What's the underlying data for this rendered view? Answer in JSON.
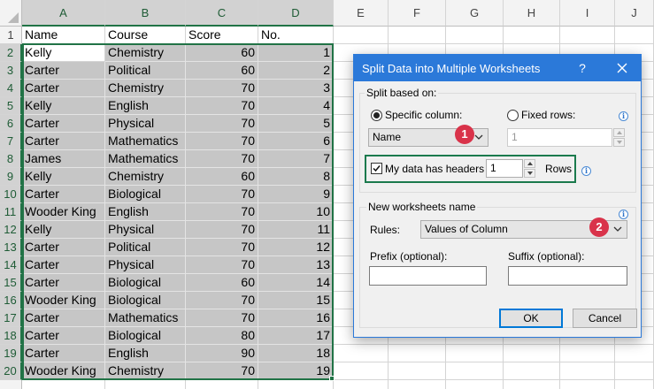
{
  "spreadsheet": {
    "columns": [
      "A",
      "B",
      "C",
      "D",
      "E",
      "F",
      "G",
      "H",
      "I",
      "J"
    ],
    "rows": [
      [
        "Name",
        "Course",
        "Score",
        "No."
      ],
      [
        "Kelly",
        "Chemistry",
        "60",
        "1"
      ],
      [
        "Carter",
        "Political",
        "60",
        "2"
      ],
      [
        "Carter",
        "Chemistry",
        "70",
        "3"
      ],
      [
        "Kelly",
        "English",
        "70",
        "4"
      ],
      [
        "Carter",
        "Physical",
        "70",
        "5"
      ],
      [
        "Carter",
        "Mathematics",
        "70",
        "6"
      ],
      [
        "James",
        "Mathematics",
        "70",
        "7"
      ],
      [
        "Kelly",
        "Chemistry",
        "60",
        "8"
      ],
      [
        "Carter",
        "Biological",
        "70",
        "9"
      ],
      [
        "Wooder King",
        "English",
        "70",
        "10"
      ],
      [
        "Kelly",
        "Physical",
        "70",
        "11"
      ],
      [
        "Carter",
        "Political",
        "70",
        "12"
      ],
      [
        "Carter",
        "Physical",
        "70",
        "13"
      ],
      [
        "Carter",
        "Biological",
        "60",
        "14"
      ],
      [
        "Wooder King",
        "Biological",
        "70",
        "15"
      ],
      [
        "Carter",
        "Mathematics",
        "70",
        "16"
      ],
      [
        "Carter",
        "Biological",
        "80",
        "17"
      ],
      [
        "Carter",
        "English",
        "90",
        "18"
      ],
      [
        "Wooder King",
        "Chemistry",
        "70",
        "19"
      ]
    ]
  },
  "dialog": {
    "title": "Split Data into Multiple Worksheets",
    "help_label": "?",
    "split_based_on": {
      "legend": "Split based on:",
      "specific_column_label": "Specific column:",
      "specific_column_selected": true,
      "column_value": "Name",
      "fixed_rows_label": "Fixed rows:",
      "fixed_rows_selected": false,
      "fixed_rows_value": "1",
      "headers_label": "My data has headers",
      "headers_checked": true,
      "header_rows_value": "1",
      "rows_label": "Rows"
    },
    "new_names": {
      "legend": "New worksheets name",
      "rules_label": "Rules:",
      "rules_value": "Values of Column",
      "prefix_label": "Prefix (optional):",
      "prefix_value": "",
      "suffix_label": "Suffix (optional):",
      "suffix_value": ""
    },
    "ok_label": "OK",
    "cancel_label": "Cancel",
    "info_glyph": "i",
    "badges": [
      "1",
      "2"
    ]
  },
  "colors": {
    "accent_blue": "#2b79d9",
    "excel_green": "#217346",
    "badge_red": "#d9334a",
    "selection_gray": "#c6c6c6"
  },
  "icons": [
    "close-icon",
    "chevron-down-icon",
    "info-icon",
    "check-icon",
    "spin-up-icon",
    "spin-down-icon"
  ]
}
